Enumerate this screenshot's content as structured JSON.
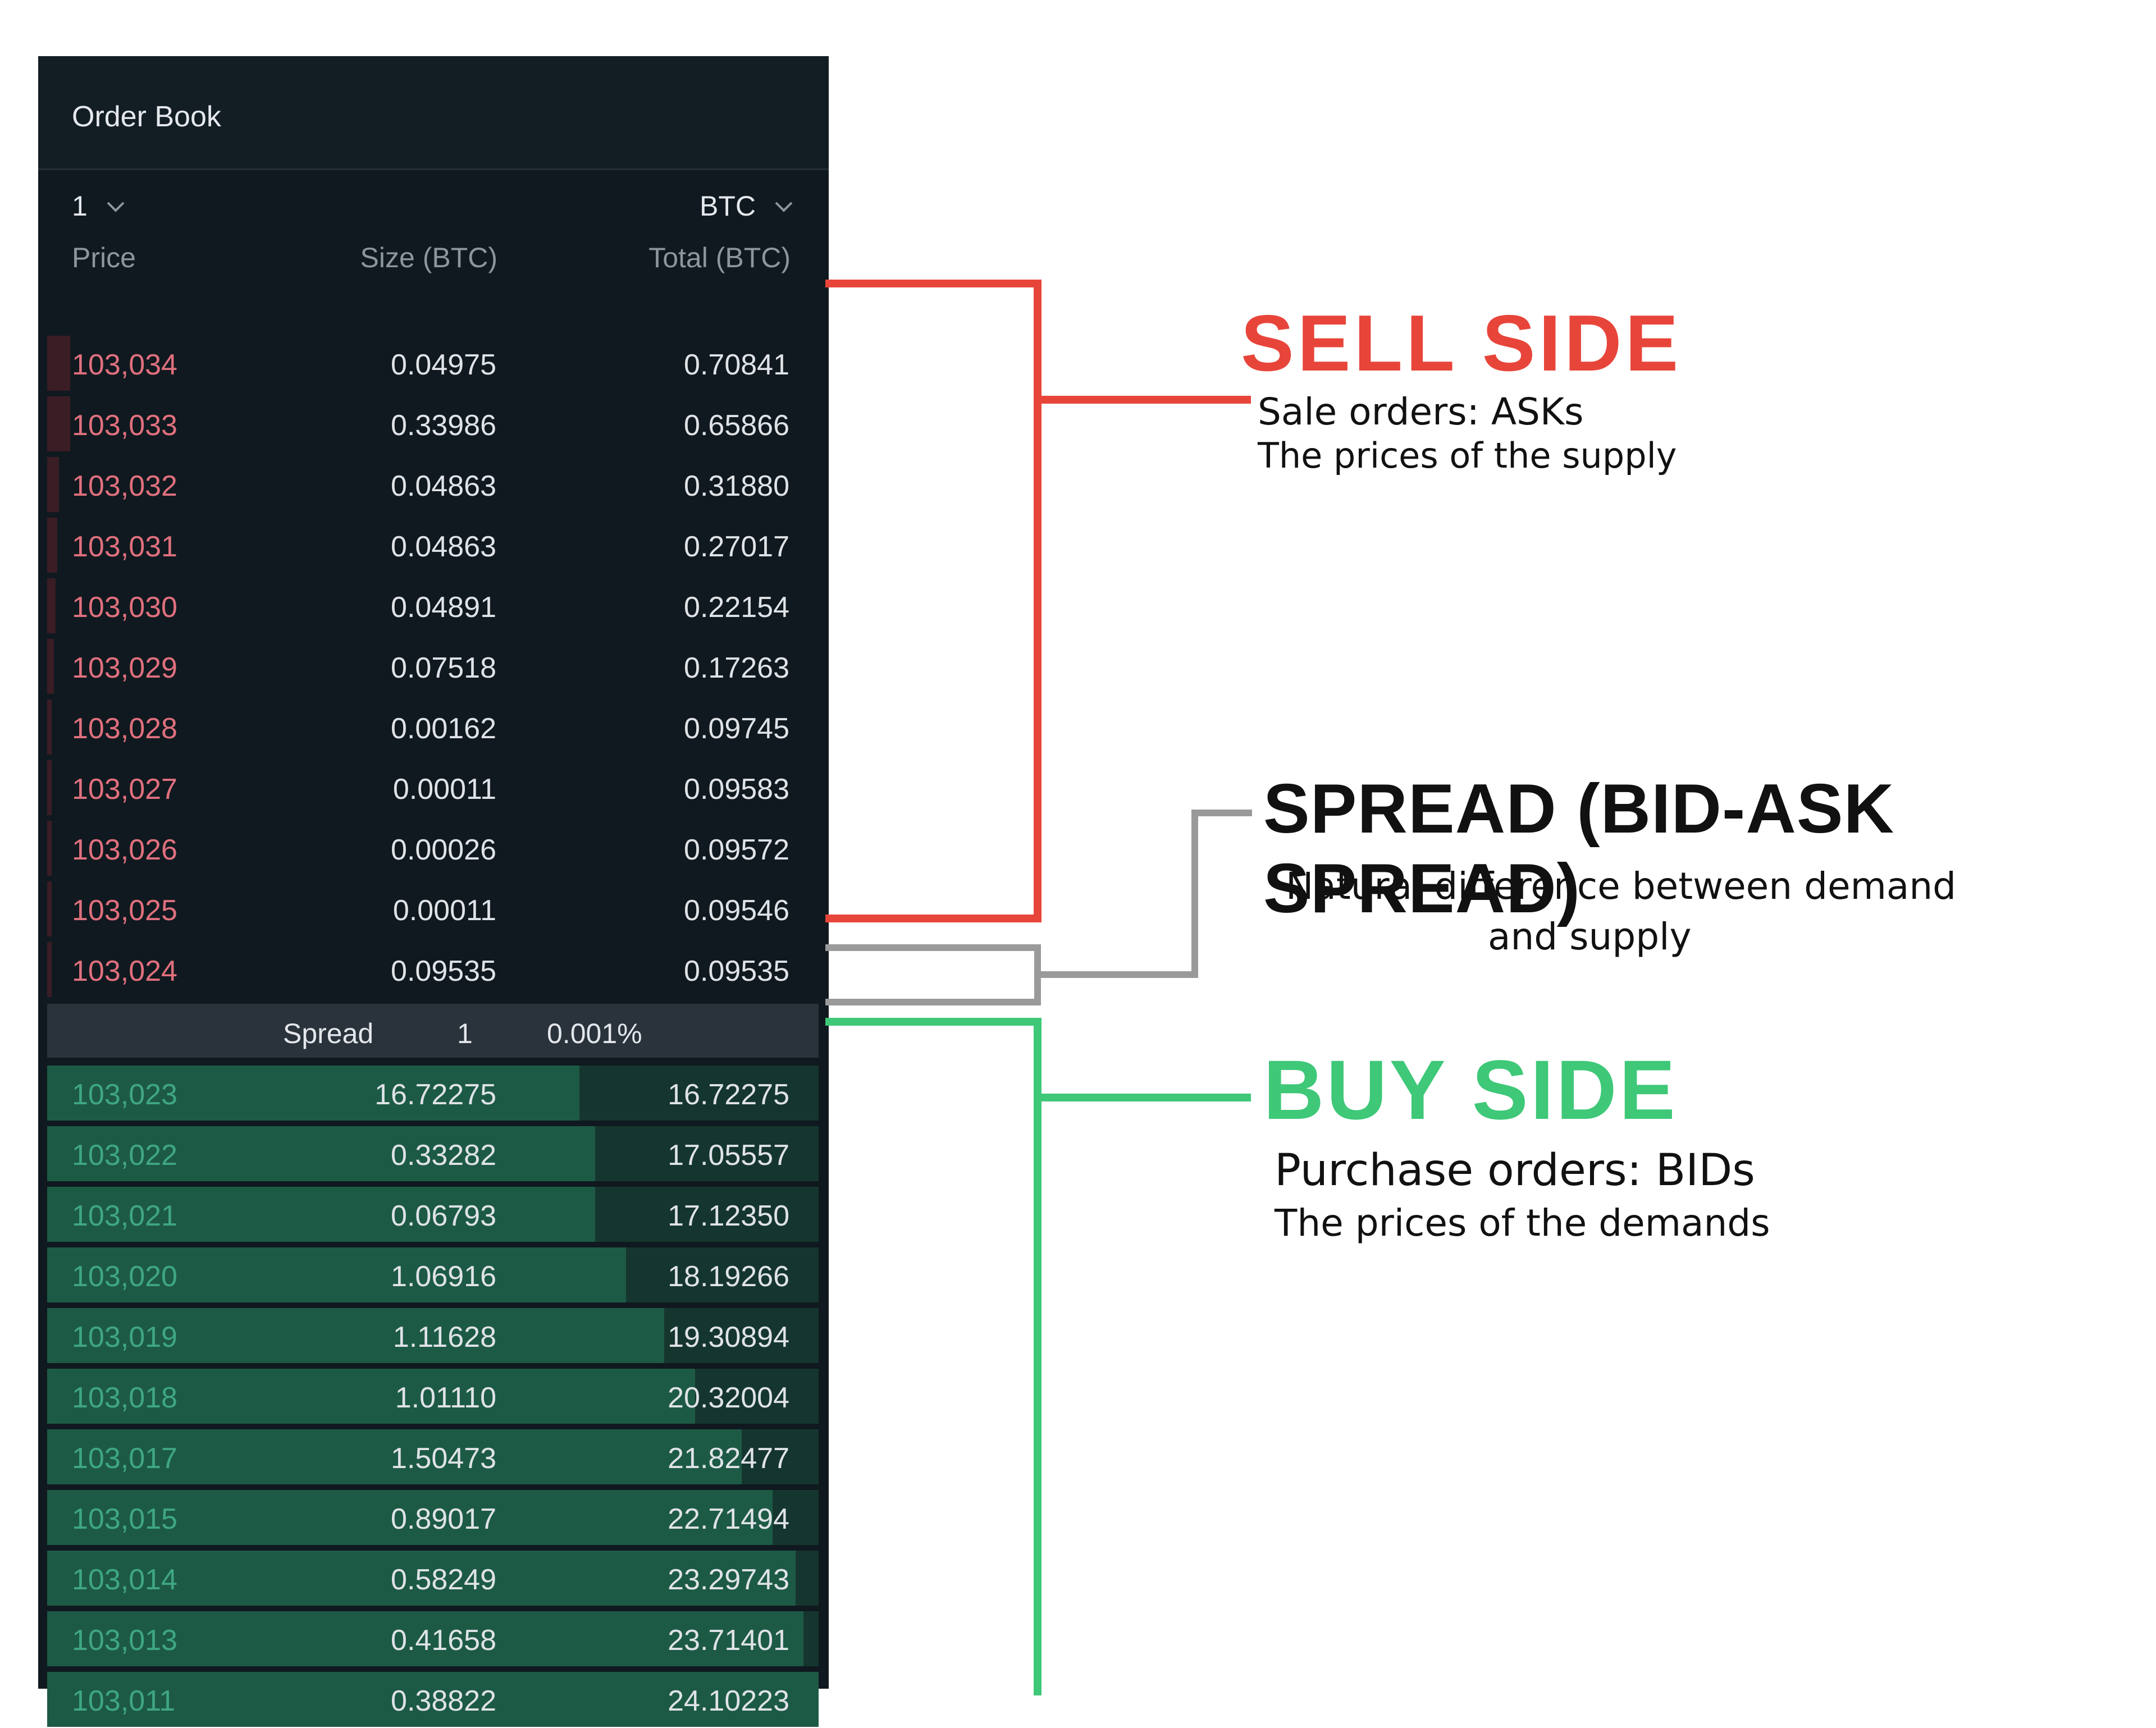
{
  "order_book": {
    "title": "Order Book",
    "precision": "1",
    "unit": "BTC",
    "columns": {
      "price": "Price",
      "size": "Size (BTC)",
      "total": "Total (BTC)"
    },
    "asks": [
      {
        "price": "103,034",
        "size": "0.04975",
        "total": "0.70841",
        "depth": 0.03
      },
      {
        "price": "103,033",
        "size": "0.33986",
        "total": "0.65866",
        "depth": 0.03
      },
      {
        "price": "103,032",
        "size": "0.04863",
        "total": "0.31880",
        "depth": 0.015
      },
      {
        "price": "103,031",
        "size": "0.04863",
        "total": "0.27017",
        "depth": 0.013
      },
      {
        "price": "103,030",
        "size": "0.04891",
        "total": "0.22154",
        "depth": 0.011
      },
      {
        "price": "103,029",
        "size": "0.07518",
        "total": "0.17263",
        "depth": 0.009
      },
      {
        "price": "103,028",
        "size": "0.00162",
        "total": "0.09745",
        "depth": 0.006
      },
      {
        "price": "103,027",
        "size": "0.00011",
        "total": "0.09583",
        "depth": 0.006
      },
      {
        "price": "103,026",
        "size": "0.00026",
        "total": "0.09572",
        "depth": 0.006
      },
      {
        "price": "103,025",
        "size": "0.00011",
        "total": "0.09546",
        "depth": 0.006
      },
      {
        "price": "103,024",
        "size": "0.09535",
        "total": "0.09535",
        "depth": 0.006
      }
    ],
    "spread": {
      "label": "Spread",
      "value": "1",
      "percent": "0.001%"
    },
    "bids": [
      {
        "price": "103,023",
        "size": "16.72275",
        "total": "16.72275",
        "size_depth": 0.69
      },
      {
        "price": "103,022",
        "size": "0.33282",
        "total": "17.05557",
        "size_depth": 0.71
      },
      {
        "price": "103,021",
        "size": "0.06793",
        "total": "17.12350",
        "size_depth": 0.71
      },
      {
        "price": "103,020",
        "size": "1.06916",
        "total": "18.19266",
        "size_depth": 0.75
      },
      {
        "price": "103,019",
        "size": "1.11628",
        "total": "19.30894",
        "size_depth": 0.8
      },
      {
        "price": "103,018",
        "size": "1.01110",
        "total": "20.32004",
        "size_depth": 0.84
      },
      {
        "price": "103,017",
        "size": "1.50473",
        "total": "21.82477",
        "size_depth": 0.9
      },
      {
        "price": "103,015",
        "size": "0.89017",
        "total": "22.71494",
        "size_depth": 0.94
      },
      {
        "price": "103,014",
        "size": "0.58249",
        "total": "23.29743",
        "size_depth": 0.97
      },
      {
        "price": "103,013",
        "size": "0.41658",
        "total": "23.71401",
        "size_depth": 0.98
      },
      {
        "price": "103,011",
        "size": "0.38822",
        "total": "24.10223",
        "size_depth": 1.0
      }
    ]
  },
  "annotations": {
    "sell": {
      "title": "SELL SIDE",
      "line1": "Sale orders: ASKs",
      "line2": "The prices of the supply"
    },
    "spread": {
      "title": "SPREAD (BID-ASK SPREAD)",
      "line1": "Natural difference between demand",
      "line2": "and supply"
    },
    "buy": {
      "title": "BUY SIDE",
      "line1": "Purchase orders: BIDs",
      "line2": "The prices of the demands"
    }
  },
  "colors": {
    "ask": "#e0707e",
    "bid": "#3fa683",
    "sell_annotation": "#e8453a",
    "spread_annotation": "#9a9a9a",
    "buy_annotation": "#3ec878"
  },
  "icons": {
    "dropdown": "chevron-down-icon"
  }
}
